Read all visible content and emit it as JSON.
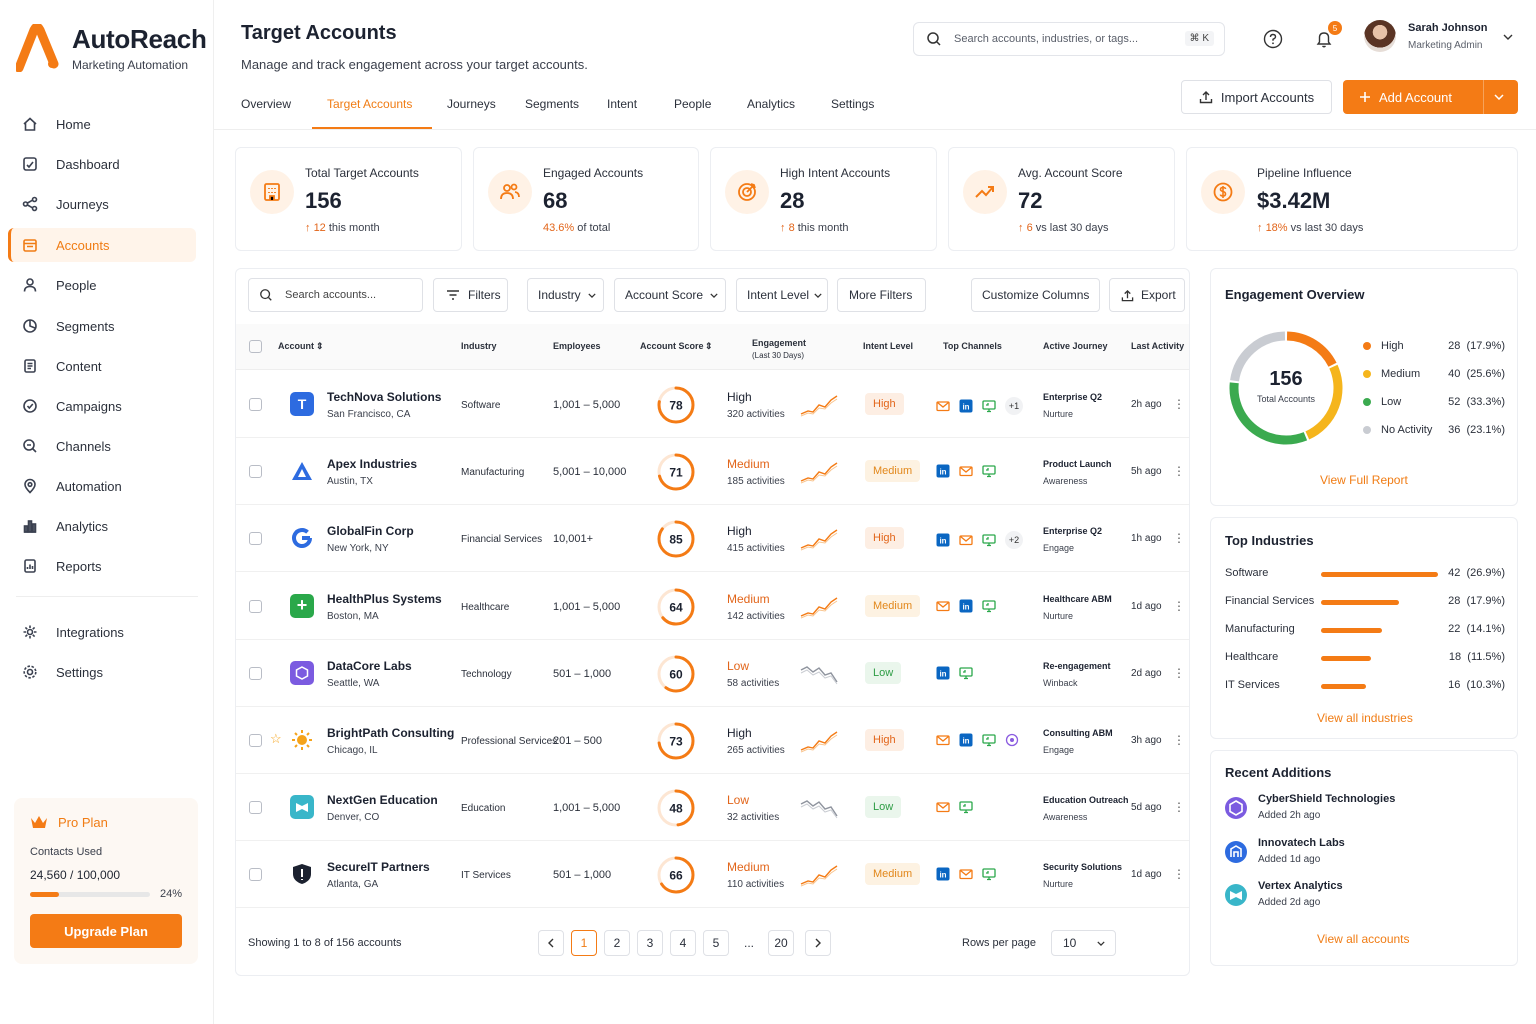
{
  "brand": {
    "name": "AutoReach",
    "tagline": "Marketing Automation",
    "accent": "#F47B15"
  },
  "sidebar": {
    "items": [
      {
        "label": "Home",
        "icon": "home-icon"
      },
      {
        "label": "Dashboard",
        "icon": "dashboard-icon"
      },
      {
        "label": "Journeys",
        "icon": "journeys-icon"
      },
      {
        "label": "Accounts",
        "icon": "accounts-icon",
        "active": true
      },
      {
        "label": "People",
        "icon": "people-icon"
      },
      {
        "label": "Segments",
        "icon": "segments-icon"
      },
      {
        "label": "Content",
        "icon": "content-icon"
      },
      {
        "label": "Campaigns",
        "icon": "campaigns-icon"
      },
      {
        "label": "Channels",
        "icon": "channels-icon"
      },
      {
        "label": "Automation",
        "icon": "automation-icon"
      },
      {
        "label": "Analytics",
        "icon": "analytics-icon"
      },
      {
        "label": "Reports",
        "icon": "reports-icon"
      }
    ],
    "bottom_items": [
      {
        "label": "Integrations",
        "icon": "integrations-icon"
      },
      {
        "label": "Settings",
        "icon": "settings-icon"
      }
    ],
    "plan": {
      "name": "Pro Plan",
      "contacts_label": "Contacts Used",
      "contacts_value": "24,560 / 100,000",
      "percent": "24%",
      "progress": 0.24,
      "upgrade_label": "Upgrade Plan"
    }
  },
  "header": {
    "title": "Target Accounts",
    "subtitle": "Manage and track engagement across your target accounts.",
    "search_placeholder": "Search accounts, industries, or tags...",
    "shortcut": "⌘ K",
    "notifications": "5",
    "user": {
      "name": "Sarah Johnson",
      "role": "Marketing Admin"
    },
    "import_label": "Import Accounts",
    "add_label": "Add Account"
  },
  "tabs": [
    "Overview",
    "Target Accounts",
    "Journeys",
    "Segments",
    "Intent",
    "People",
    "Analytics",
    "Settings"
  ],
  "active_tab": "Target Accounts",
  "kpis": [
    {
      "label": "Total Target Accounts",
      "value": "156",
      "delta": "12",
      "delta_text": "this month",
      "icon": "building-icon"
    },
    {
      "label": "Engaged Accounts",
      "value": "68",
      "delta": "43.6%",
      "delta_text": "of total",
      "icon": "users-icon"
    },
    {
      "label": "High Intent Accounts",
      "value": "28",
      "delta": "8",
      "delta_text": "this month",
      "icon": "target-icon"
    },
    {
      "label": "Avg. Account Score",
      "value": "72",
      "delta": "6",
      "delta_text": "vs last 30 days",
      "icon": "trend-icon"
    },
    {
      "label": "Pipeline Influence",
      "value": "$3.42M",
      "delta": "18%",
      "delta_text": "vs last 30 days",
      "icon": "dollar-icon"
    }
  ],
  "filters": {
    "search_placeholder": "Search accounts...",
    "filters_label": "Filters",
    "industry_label": "Industry",
    "score_label": "Account Score",
    "intent_label": "Intent Level",
    "more_label": "More Filters",
    "customize_label": "Customize Columns",
    "export_label": "Export"
  },
  "table": {
    "columns": {
      "account": "Account",
      "industry": "Industry",
      "employees": "Employees",
      "score": "Account Score",
      "engagement": "Engagement",
      "engagement_sub": "(Last 30 Days)",
      "intent": "Intent Level",
      "channels": "Top Channels",
      "journey": "Active Journey",
      "activity": "Last Activity"
    },
    "rows": [
      {
        "name": "TechNova Solutions",
        "location": "San Francisco, CA",
        "industry": "Software",
        "employees": "1,001 – 5,000",
        "score": 78,
        "engagement": "High",
        "activities": "320 activities",
        "intent": "High",
        "channels": [
          "email",
          "linkedin",
          "web"
        ],
        "extra": "+1",
        "journey": "Enterprise Q2",
        "stage": "Nurture",
        "last": "2h ago",
        "logo_color": "#2d6be0",
        "logo_text": "T",
        "trend": "up"
      },
      {
        "name": "Apex Industries",
        "location": "Austin, TX",
        "industry": "Manufacturing",
        "employees": "5,001 – 10,000",
        "score": 71,
        "engagement": "Medium",
        "activities": "185 activities",
        "intent": "Medium",
        "channels": [
          "linkedin",
          "email",
          "web"
        ],
        "extra": "",
        "journey": "Product Launch",
        "stage": "Awareness",
        "last": "5h ago",
        "logo_color": "#2d6be0",
        "logo_text": "▲",
        "trend": "up"
      },
      {
        "name": "GlobalFin Corp",
        "location": "New York, NY",
        "industry": "Financial Services",
        "employees": "10,001+",
        "score": 85,
        "engagement": "High",
        "activities": "415 activities",
        "intent": "High",
        "channels": [
          "linkedin",
          "email",
          "web"
        ],
        "extra": "+2",
        "journey": "Enterprise Q2",
        "stage": "Engage",
        "last": "1h ago",
        "logo_color": "#2d6be0",
        "logo_text": "G",
        "trend": "up"
      },
      {
        "name": "HealthPlus Systems",
        "location": "Boston, MA",
        "industry": "Healthcare",
        "employees": "1,001 – 5,000",
        "score": 64,
        "engagement": "Medium",
        "activities": "142 activities",
        "intent": "Medium",
        "channels": [
          "email",
          "linkedin",
          "web"
        ],
        "extra": "",
        "journey": "Healthcare ABM",
        "stage": "Nurture",
        "last": "1d ago",
        "logo_color": "#2aa84a",
        "logo_text": "+",
        "trend": "up"
      },
      {
        "name": "DataCore Labs",
        "location": "Seattle, WA",
        "industry": "Technology",
        "employees": "501 – 1,000",
        "score": 60,
        "engagement": "Low",
        "activities": "58 activities",
        "intent": "Low",
        "channels": [
          "linkedin",
          "web"
        ],
        "extra": "",
        "journey": "Re-engagement",
        "stage": "Winback",
        "last": "2d ago",
        "logo_color": "#7b5be0",
        "logo_text": "⬡",
        "trend": "down"
      },
      {
        "name": "BrightPath Consulting",
        "location": "Chicago, IL",
        "industry": "Professional Services",
        "employees": "201 – 500",
        "score": 73,
        "engagement": "High",
        "activities": "265 activities",
        "intent": "High",
        "channels": [
          "email",
          "linkedin",
          "web",
          "other"
        ],
        "extra": "",
        "journey": "Consulting ABM",
        "stage": "Engage",
        "last": "3h ago",
        "logo_color": "#f5a31a",
        "logo_text": "✺",
        "trend": "up"
      },
      {
        "name": "NextGen Education",
        "location": "Denver, CO",
        "industry": "Education",
        "employees": "1,001 – 5,000",
        "score": 48,
        "engagement": "Low",
        "activities": "32 activities",
        "intent": "Low",
        "channels": [
          "email",
          "web"
        ],
        "extra": "",
        "journey": "Education Outreach",
        "stage": "Awareness",
        "last": "5d ago",
        "logo_color": "#39b6c9",
        "logo_text": "M",
        "trend": "down"
      },
      {
        "name": "SecureIT Partners",
        "location": "Atlanta, GA",
        "industry": "IT Services",
        "employees": "501 – 1,000",
        "score": 66,
        "engagement": "Medium",
        "activities": "110 activities",
        "intent": "Medium",
        "channels": [
          "linkedin",
          "email",
          "web"
        ],
        "extra": "",
        "journey": "Security Solutions",
        "stage": "Nurture",
        "last": "1d ago",
        "logo_color": "#1c2230",
        "logo_text": "◆",
        "trend": "up"
      }
    ],
    "footer": {
      "showing": "Showing 1 to 8 of 156 accounts",
      "pages": [
        "1",
        "2",
        "3",
        "4",
        "5",
        "...",
        "20"
      ],
      "rows_label": "Rows per page",
      "rows_value": "10"
    }
  },
  "engagement_overview": {
    "title": "Engagement Overview",
    "total": "156",
    "total_label": "Total Accounts",
    "segments": [
      {
        "label": "High",
        "count": "28",
        "pct": "(17.9%)",
        "color": "#F47B15",
        "value": 28
      },
      {
        "label": "Medium",
        "count": "40",
        "pct": "(25.6%)",
        "color": "#F5B51C",
        "value": 40
      },
      {
        "label": "Low",
        "count": "52",
        "pct": "(33.3%)",
        "color": "#3BAA4F",
        "value": 52
      },
      {
        "label": "No Activity",
        "count": "36",
        "pct": "(23.1%)",
        "color": "#C9CCD2",
        "value": 36
      }
    ],
    "link": "View Full Report"
  },
  "top_industries": {
    "title": "Top Industries",
    "items": [
      {
        "label": "Software",
        "count": "42",
        "pct": "(26.9%)",
        "value": 42
      },
      {
        "label": "Financial Services",
        "count": "28",
        "pct": "(17.9%)",
        "value": 28
      },
      {
        "label": "Manufacturing",
        "count": "22",
        "pct": "(14.1%)",
        "value": 22
      },
      {
        "label": "Healthcare",
        "count": "18",
        "pct": "(11.5%)",
        "value": 18
      },
      {
        "label": "IT Services",
        "count": "16",
        "pct": "(10.3%)",
        "value": 16
      }
    ],
    "link": "View all industries"
  },
  "recent": {
    "title": "Recent Additions",
    "items": [
      {
        "name": "CyberShield Technologies",
        "time": "Added 2h ago",
        "color": "#7b5be0"
      },
      {
        "name": "Innovatech Labs",
        "time": "Added 1d ago",
        "color": "#2d6be0"
      },
      {
        "name": "Vertex Analytics",
        "time": "Added 2d ago",
        "color": "#39b6c9"
      }
    ],
    "link": "View all accounts"
  }
}
